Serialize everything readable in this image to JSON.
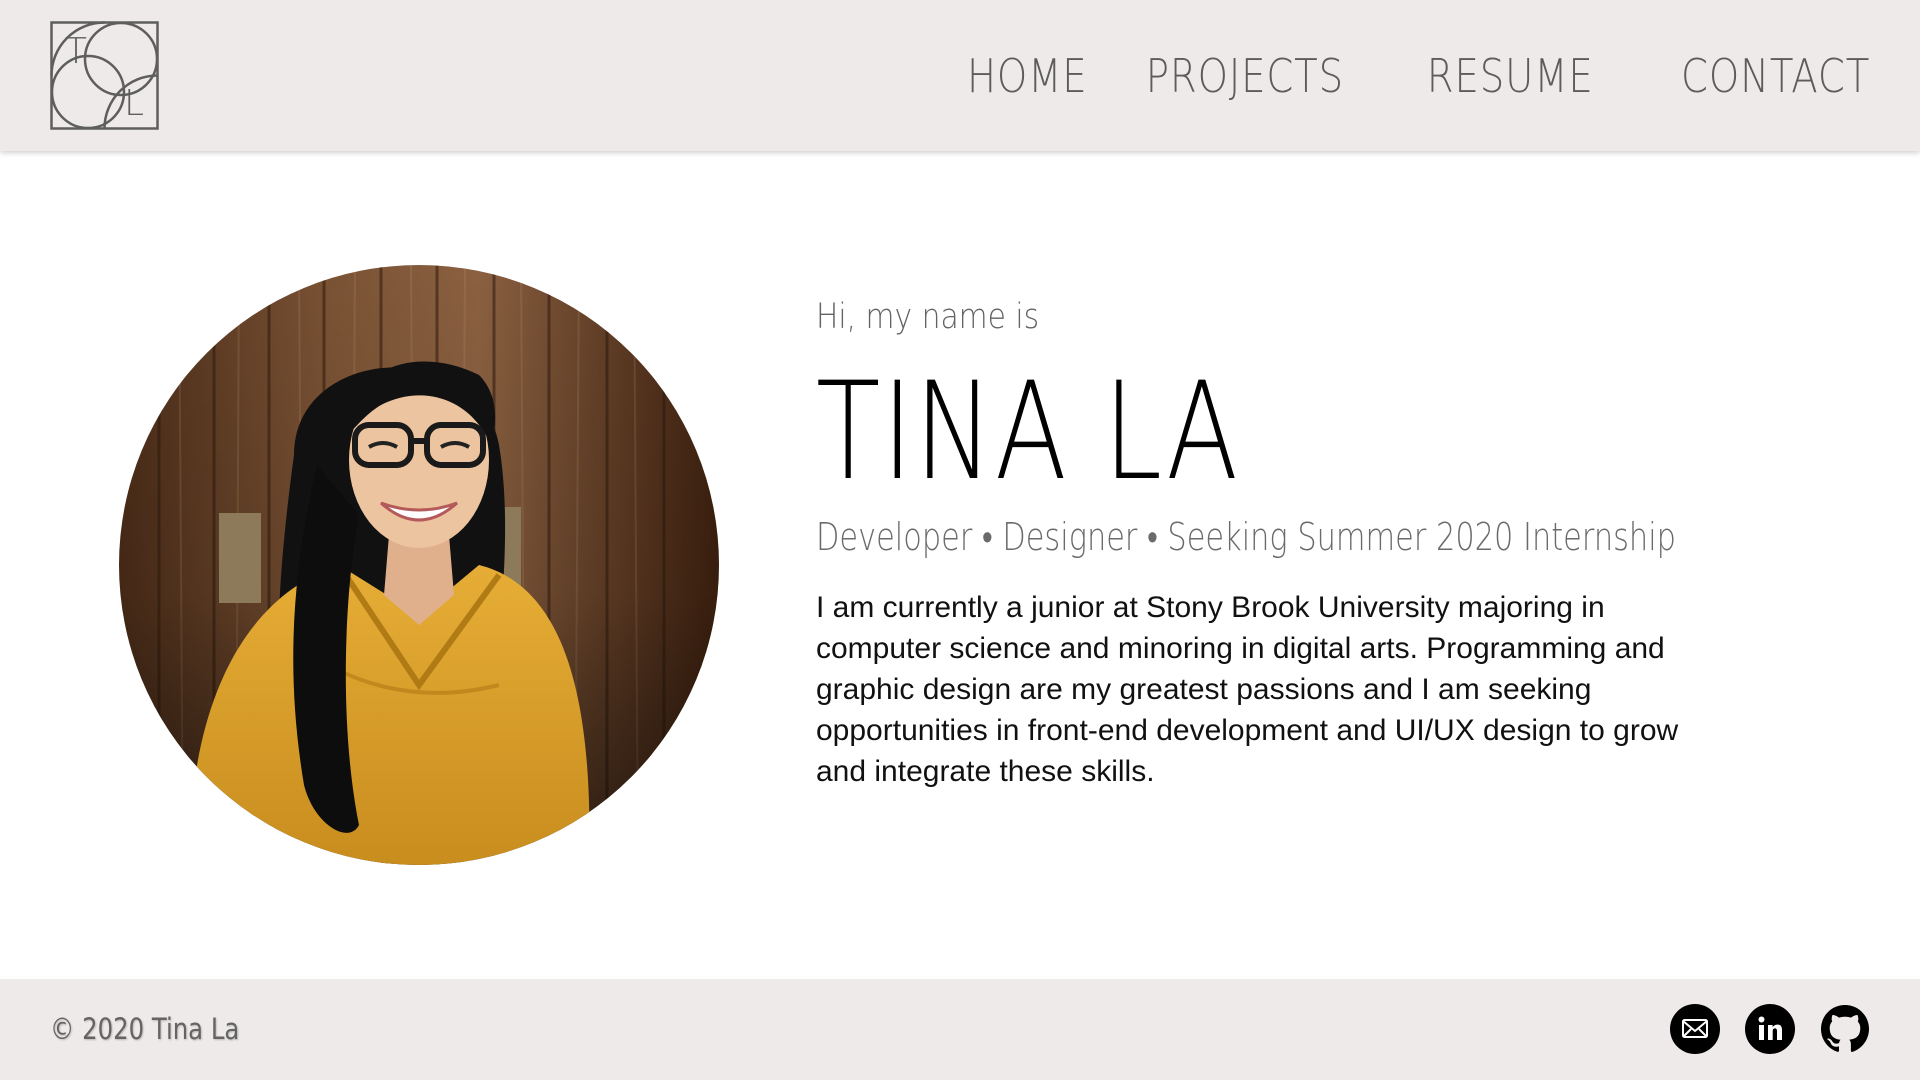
{
  "header": {
    "logo": {
      "letters": [
        "T",
        "L"
      ],
      "icon": "tl-monogram-logo"
    },
    "nav": [
      {
        "label": "HOME"
      },
      {
        "label": "PROJECTS"
      },
      {
        "label": "RESUME"
      },
      {
        "label": "CONTACT"
      }
    ]
  },
  "hero": {
    "greeting": "Hi, my name is",
    "name": "TINA LA",
    "tagline": "Developer • Designer • Seeking Summer 2020 Internship",
    "bio": "I am currently a junior at Stony Brook University majoring in computer science and minoring in digital arts. Programming and graphic design are my greatest passions and I am seeking opportunities in front-end development and UI/UX design to grow and integrate these skills."
  },
  "footer": {
    "copyright": "© 2020 Tina La",
    "social": [
      {
        "icon": "email-icon"
      },
      {
        "icon": "linkedin-icon"
      },
      {
        "icon": "github-icon"
      }
    ]
  },
  "colors": {
    "header_bg": "#eeeae9",
    "footer_bg": "#eeeae9",
    "nav_text": "#5c5c5c",
    "name_text": "#000000",
    "sweater": "#e0a52b",
    "wood": "#6b4325"
  }
}
